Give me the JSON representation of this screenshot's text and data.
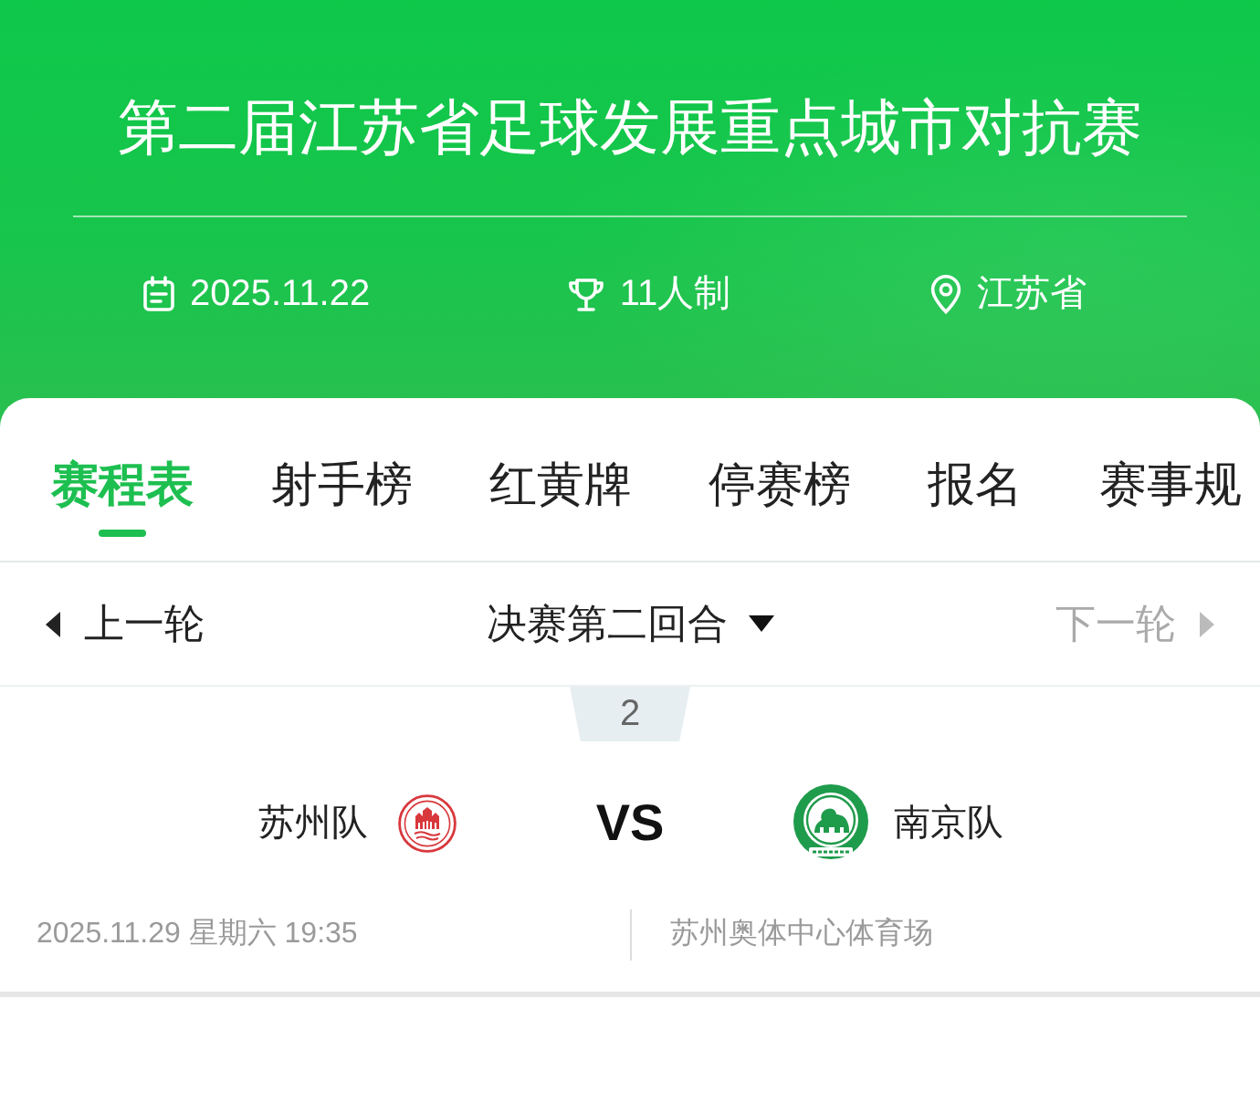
{
  "header": {
    "title": "第二届江苏省足球发展重点城市对抗赛",
    "date": "2025.11.22",
    "format": "11人制",
    "location": "江苏省"
  },
  "tabs": [
    {
      "label": "赛程表",
      "selected": true
    },
    {
      "label": "射手榜",
      "selected": false
    },
    {
      "label": "红黄牌",
      "selected": false
    },
    {
      "label": "停赛榜",
      "selected": false
    },
    {
      "label": "报名",
      "selected": false
    },
    {
      "label": "赛事规",
      "selected": false
    }
  ],
  "round_nav": {
    "previous": {
      "label": "上一轮",
      "disabled": false
    },
    "current": "决赛第二回合",
    "next": {
      "label": "下一轮",
      "disabled": true
    }
  },
  "matches": [
    {
      "number": "2",
      "home_team": "苏州队",
      "vs": "VS",
      "away_team": "南京队",
      "datetime": "2025.11.29 星期六 19:35",
      "venue": "苏州奥体中心体育场"
    }
  ]
}
